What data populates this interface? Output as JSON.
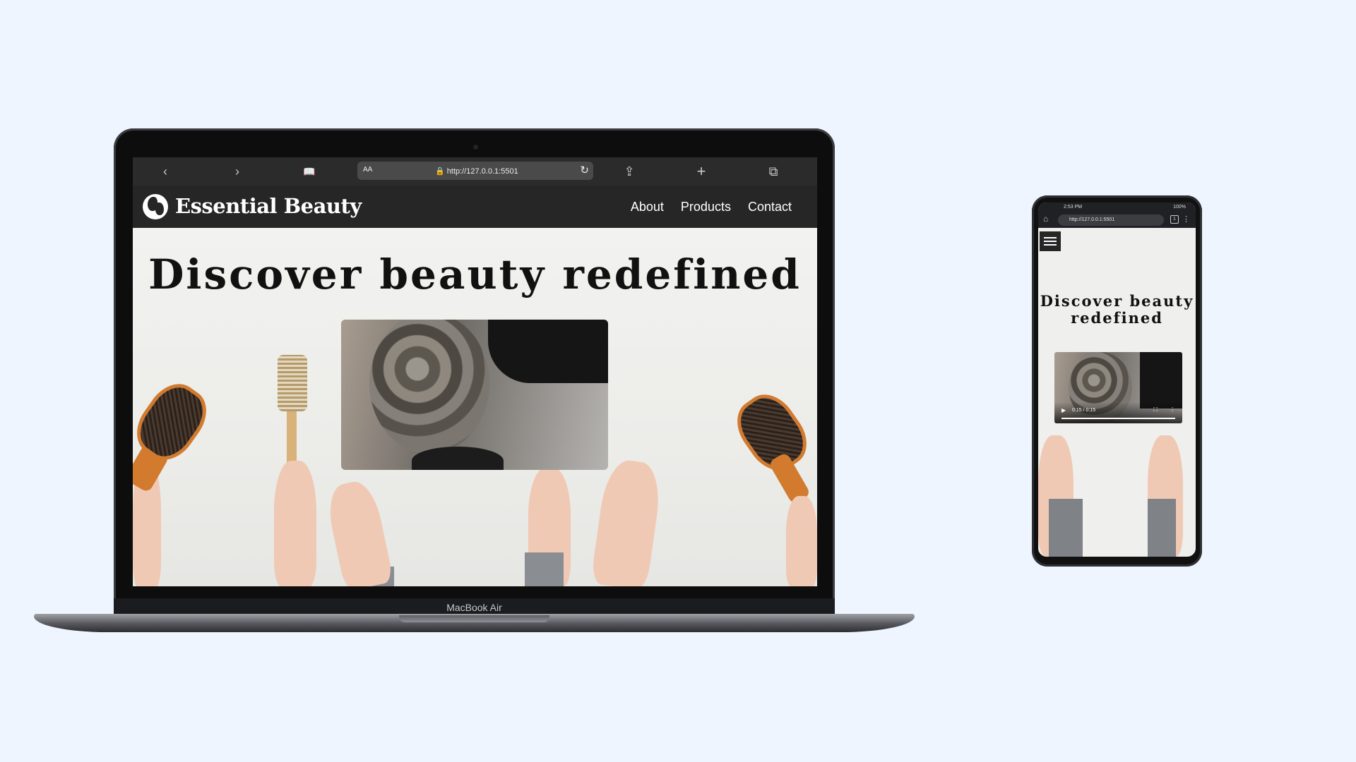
{
  "laptop": {
    "device_label": "MacBook Air",
    "browser": {
      "url": "http://127.0.0.1:5501",
      "text_size_label": "AA",
      "back_glyph": "‹",
      "forward_glyph": "›",
      "bookmarks_glyph": "📖",
      "share_glyph": "⇪",
      "new_tab_glyph": "+",
      "tabs_glyph": "⧉",
      "reload_glyph": "↻"
    },
    "site": {
      "brand": "Essential Beauty",
      "nav": [
        "About",
        "Products",
        "Contact"
      ],
      "hero_title": "Discover beauty redefined"
    }
  },
  "phone": {
    "status_time": "2:53 PM",
    "status_battery": "100%",
    "url": "http://127.0.0.1:5501",
    "hero_title_line1": "Discover beauty",
    "hero_title_line2": "redefined",
    "video_time": "0:15 / 0:15"
  },
  "colors": {
    "background": "#eef5ff",
    "header": "#262626",
    "hero_text": "#111111"
  }
}
